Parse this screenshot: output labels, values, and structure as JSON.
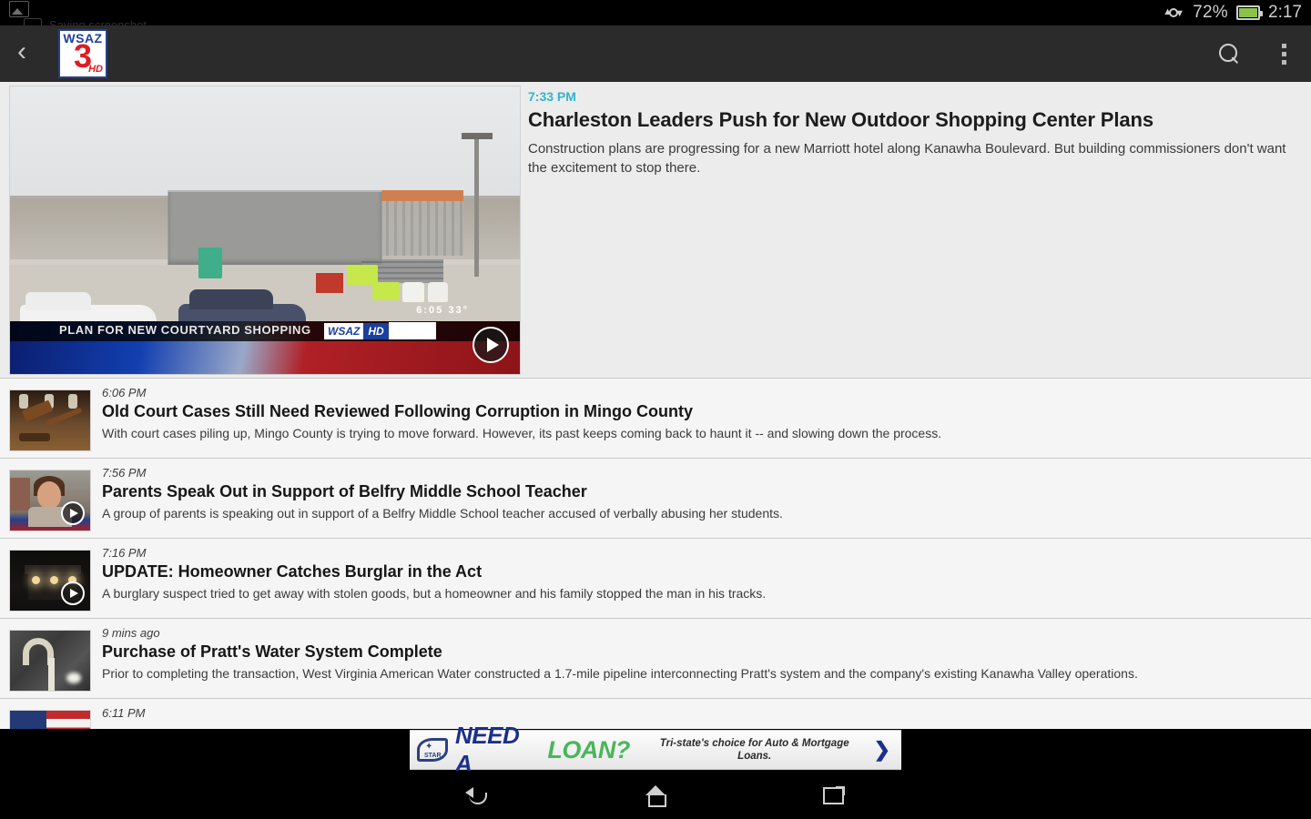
{
  "status_bar": {
    "notification_icon": "screenshot-image-icon",
    "notification_text": "Saving screenshot...",
    "sync_icon": "sync-arrows-icon",
    "battery_percent": "72%",
    "time": "2:17"
  },
  "app_bar": {
    "back_label": "‹",
    "logo": {
      "line1": "WSAZ",
      "line2": "3",
      "line3": "HD"
    },
    "search_icon": "search-icon",
    "overflow_icon": "overflow-menu-icon"
  },
  "featured": {
    "time": "7:33 PM",
    "title": "Charleston Leaders Push for New Outdoor Shopping Center Plans",
    "summary": "Construction plans are progressing for a new Marriott hotel along Kanawha Boulevard. But building commissioners don't want the excitement to stop there.",
    "overlay_caption": "PLAN FOR NEW COURTYARD SHOPPING",
    "overlay_logo_a": "WSAZ",
    "overlay_logo_b": "HD",
    "overlay_clock": "6:05   33°",
    "has_video": true,
    "play_icon": "play-button-icon",
    "accent_color": "#2fb6ca"
  },
  "articles": [
    {
      "time": "6:06 PM",
      "title": "Old Court Cases Still Need Reviewed Following Corruption in Mingo County",
      "summary": "With court cases piling up, Mingo County is trying to move forward. However, its past keeps coming back to haunt it -- and slowing down the process.",
      "thumb": "gavel-courtroom-thumbnail",
      "has_video": false
    },
    {
      "time": "7:56 PM",
      "title": "Parents Speak Out in Support of Belfry Middle School Teacher",
      "summary": "A group of parents is speaking out in support of a Belfry Middle School teacher accused of verbally abusing her students.",
      "thumb": "woman-interview-thumbnail",
      "has_video": true
    },
    {
      "time": "7:16 PM",
      "title": "UPDATE: Homeowner Catches Burglar in the Act",
      "summary": "A burglary suspect tried to get away with stolen goods, but a homeowner and his family stopped the man in his tracks.",
      "thumb": "house-at-night-thumbnail",
      "has_video": true
    },
    {
      "time": "9 mins ago",
      "title": "Purchase of Pratt's Water System Complete",
      "summary": "Prior to completing the transaction, West Virginia American Water constructed a 1.7-mile pipeline interconnecting Pratt's system and the company's existing Kanawha Valley operations.",
      "thumb": "faucet-water-thumbnail",
      "has_video": false
    },
    {
      "time": "6:11 PM",
      "title": "",
      "summary": "",
      "thumb": "american-flag-thumbnail",
      "has_video": false
    }
  ],
  "ad": {
    "logo_text": "STAR",
    "headline_1": "NEED A",
    "headline_2": "LOAN?",
    "subtext": "Tri-state's choice for Auto & Mortgage Loans.",
    "arrow": "❯"
  },
  "nav_bar": {
    "back_icon": "back-arrow-icon",
    "home_icon": "home-icon",
    "recents_icon": "recent-apps-icon"
  }
}
